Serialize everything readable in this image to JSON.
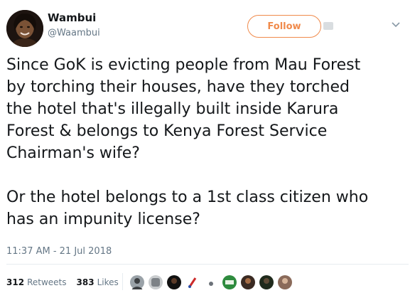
{
  "author": {
    "display_name": "Wambui",
    "handle": "@Waambui"
  },
  "follow": {
    "label": "Follow"
  },
  "tweet": {
    "text": "Since GoK is evicting people from Mau Forest\nby torching their houses, have they torched\nthe hotel that's illegally built inside Karura\nForest & belongs to Kenya Forest Service\nChairman's wife?\n\nOr the hotel belongs to a 1st class citizen who\nhas an impunity license?",
    "timestamp": "11:37 AM - 21 Jul 2018"
  },
  "stats": {
    "retweets_count": "312",
    "retweets_label": "Retweets",
    "likes_count": "383",
    "likes_label": "Likes"
  },
  "colors": {
    "follow_accent": "#f08a4b",
    "text": "#14171a",
    "muted": "#657786"
  },
  "likers": [
    {
      "icon": "liker-avatar"
    },
    {
      "icon": "liker-avatar"
    },
    {
      "icon": "liker-avatar"
    },
    {
      "icon": "liker-avatar"
    },
    {
      "icon": "liker-avatar"
    },
    {
      "icon": "liker-avatar"
    },
    {
      "icon": "liker-avatar"
    },
    {
      "icon": "liker-avatar"
    },
    {
      "icon": "liker-avatar"
    },
    {
      "icon": "liker-avatar"
    }
  ]
}
